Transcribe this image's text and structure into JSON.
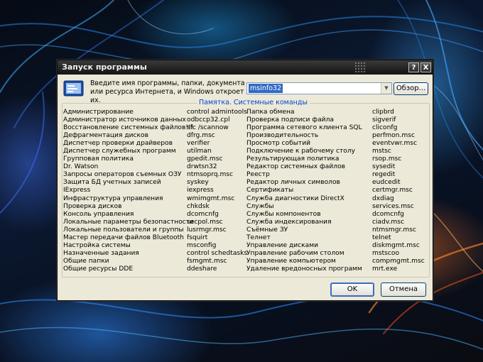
{
  "window": {
    "title": "Запуск программы",
    "help_button": "?",
    "close_button": "X"
  },
  "instruction": "Введите имя программы, папки, документа или ресурса Интернета, и Windows откроет их.",
  "command_input": {
    "value": "msinfo32"
  },
  "browse_button": "Обзор...",
  "memo_title": "Памятка. Системные команды",
  "commands": {
    "col1": [
      "Администрирование",
      "Администратор источников данных",
      "Восстановление системных файлов!!!",
      "Дефрагментация дисков",
      "Диспетчер проверки драйверов",
      "Диспетчер служебных программ",
      "Групповая политика",
      "Dr. Watson",
      "Запросы операторов съемных ОЗУ",
      "Защита БД учетных записей",
      "IExpress",
      "Инфраструктура управления",
      "Проверка дисков",
      "Консоль управления",
      "Локальные параметры безопастности",
      "Локальные пользователи и группы",
      "Мастер передачи файлов Bluetooth",
      "Настройка системы",
      "Назначенные задания",
      "Общие папки",
      "Общие ресурсы DDE"
    ],
    "col2": [
      "control admintools",
      "odbccp32.cpl",
      "sfc /scannow",
      "dfrg.msc",
      "verifier",
      "utilman",
      "gpedit.msc",
      "drwtsn32",
      "ntmsoprq.msc",
      "syskey",
      "iexpress",
      "wmimgmt.msc",
      "chkdsk",
      "dcomcnfg",
      "secpol.msc",
      "lusrmgr.msc",
      "fsquirt",
      "msconfig",
      "control schedtasks",
      "fsmgmt.msc",
      "ddeshare"
    ],
    "col3": [
      "Папка обмена",
      "Проверка подписи файла",
      "Программа сетевого клиента SQL",
      "Производительность",
      "Просмотр событий",
      "Подключение к рабочему столу",
      "Результирующая политика",
      "Редактор системных файлов",
      "Реестр",
      "Редактор личных символов",
      "Сертификаты",
      "Служба диагностики DirectX",
      "Службы",
      "Службы компонентов",
      "Служба индексирования",
      "Съёмные ЗУ",
      "Телнет",
      "Управление дисками",
      "Управление рабочим столом",
      "Управление компьютером",
      "Удаление вредоносных программ"
    ],
    "col4": [
      "clipbrd",
      "sigverif",
      "cliconfg",
      "perfmon.msc",
      "eventvwr.msc",
      "mstsc",
      "rsop.msc",
      "sysedit",
      "regedit",
      "eudcedit",
      "certmgr.msc",
      "dxdiag",
      "services.msc",
      "dcomcnfg",
      "ciadv.msc",
      "ntmsmgr.msc",
      "telnet",
      "diskmgmt.msc",
      "mstscoo",
      "compmgmt.msc",
      "mrt.exe"
    ]
  },
  "ok_button": "OK",
  "cancel_button": "Отмена",
  "colors": {
    "dialog_bg": "#ece9d8",
    "titlebar": "#1e1e1e",
    "memo_title": "#0046d5",
    "selection": "#316ac5"
  },
  "icons": {
    "run": "run-program-icon",
    "dropdown": "chevron-down-icon"
  }
}
